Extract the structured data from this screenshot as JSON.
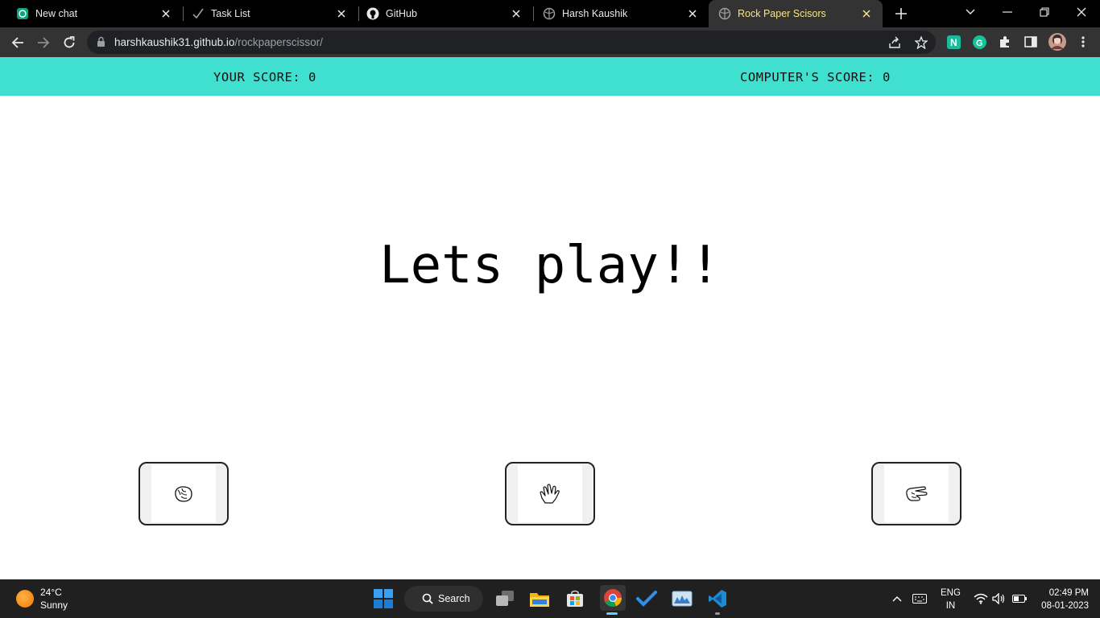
{
  "browser": {
    "tabs": [
      {
        "title": "New chat",
        "icon": "openai-icon"
      },
      {
        "title": "Task List",
        "icon": "checkmark-icon"
      },
      {
        "title": "GitHub",
        "icon": "github-icon"
      },
      {
        "title": "Harsh Kaushik",
        "icon": "globe-icon"
      },
      {
        "title": "Rock Paper Scisors",
        "icon": "globe-icon",
        "active": true
      }
    ],
    "url_host": "harshkaushik31.github.io",
    "url_path": "/rockpaperscissor/"
  },
  "page": {
    "your_score_label": "YOUR SCORE: 0",
    "computer_score_label": "COMPUTER'S SCORE: 0",
    "headline": "Lets play!!",
    "choices": [
      {
        "name": "rock",
        "icon": "fist-icon"
      },
      {
        "name": "paper",
        "icon": "open-hand-icon"
      },
      {
        "name": "scissor",
        "icon": "scissor-hand-icon"
      }
    ],
    "accent_color": "#40e0d0"
  },
  "taskbar": {
    "weather_temp": "24°C",
    "weather_cond": "Sunny",
    "search_label": "Search",
    "lang_line1": "ENG",
    "lang_line2": "IN",
    "time": "02:49 PM",
    "date": "08-01-2023"
  }
}
